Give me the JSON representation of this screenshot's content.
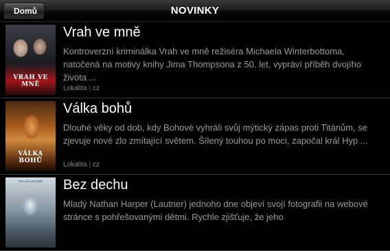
{
  "navbar": {
    "back_label": "Domů",
    "title": "NOVINKY"
  },
  "movies": [
    {
      "title": "Vrah ve mně",
      "description": "Kontroverzní kriminálka Vrah ve mně režiséra Michaela Winterbottoma, natočená na motivy knihy Jima Thompsona z 50. let, vypráví příběh dvojího života  ...",
      "tag_1": "Lokalita",
      "tag_2": "cz",
      "poster_text": "VRAH VE MNĚ"
    },
    {
      "title": "Válka bohů",
      "description": "Dlouhé věky od dob, kdy Bohové vyhráli svůj mýtický zápas proti Titánům, se zjevuje nové zlo zmítající světem. Šílený touhou po moci, započal král Hyp ...",
      "tag_1": "Lokalita",
      "tag_2": "cz",
      "poster_text": "VÁLKA BOHŮ"
    },
    {
      "title": "Bez dechu",
      "description": "Mladý Nathan Harper (Lautner) jednoho dne objeví svojí fotografii na webové stránce s pohřešovanými dětmi. Rychle zjišťuje, že jeho",
      "poster_text": "TAYLOR LAUTNER"
    }
  ]
}
